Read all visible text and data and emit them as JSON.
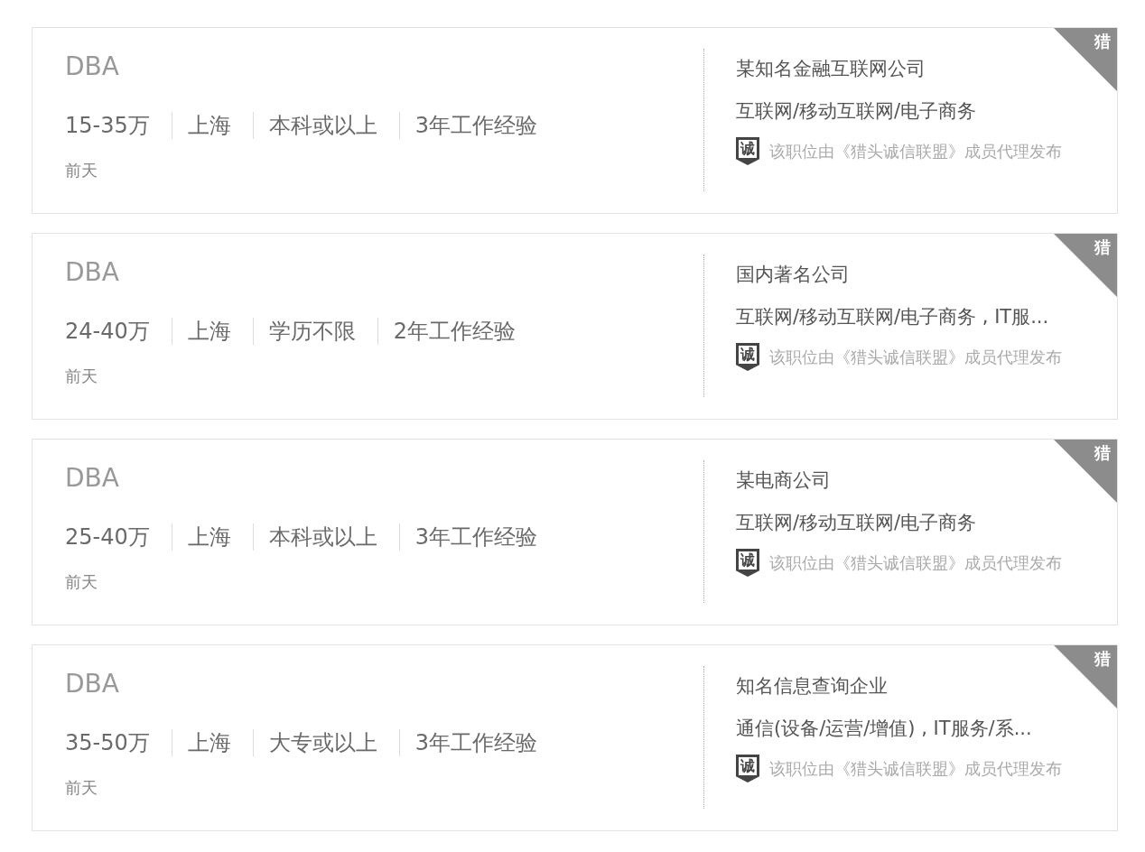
{
  "jobs": [
    {
      "title": "DBA",
      "details": [
        "15-35万",
        "上海",
        "本科或以上",
        "3年工作经验"
      ],
      "posted": "前天",
      "company": "某知名金融互联网公司",
      "industry": "互联网/移动互联网/电子商务",
      "badge": "诚",
      "notice": "该职位由《猎头诚信联盟》成员代理发布",
      "corner_tag": "猎"
    },
    {
      "title": "DBA",
      "details": [
        "24-40万",
        "上海",
        "学历不限",
        "2年工作经验"
      ],
      "posted": "前天",
      "company": "国内著名公司",
      "industry": "互联网/移动互联网/电子商务 , IT服...",
      "badge": "诚",
      "notice": "该职位由《猎头诚信联盟》成员代理发布",
      "corner_tag": "猎"
    },
    {
      "title": "DBA",
      "details": [
        "25-40万",
        "上海",
        "本科或以上",
        "3年工作经验"
      ],
      "posted": "前天",
      "company": "某电商公司",
      "industry": "互联网/移动互联网/电子商务",
      "badge": "诚",
      "notice": "该职位由《猎头诚信联盟》成员代理发布",
      "corner_tag": "猎"
    },
    {
      "title": "DBA",
      "details": [
        "35-50万",
        "上海",
        "大专或以上",
        "3年工作经验"
      ],
      "posted": "前天",
      "company": "知名信息查询企业",
      "industry": "通信(设备/运营/增值) , IT服务/系...",
      "badge": "诚",
      "notice": "该职位由《猎头诚信联盟》成员代理发布",
      "corner_tag": "猎"
    }
  ]
}
